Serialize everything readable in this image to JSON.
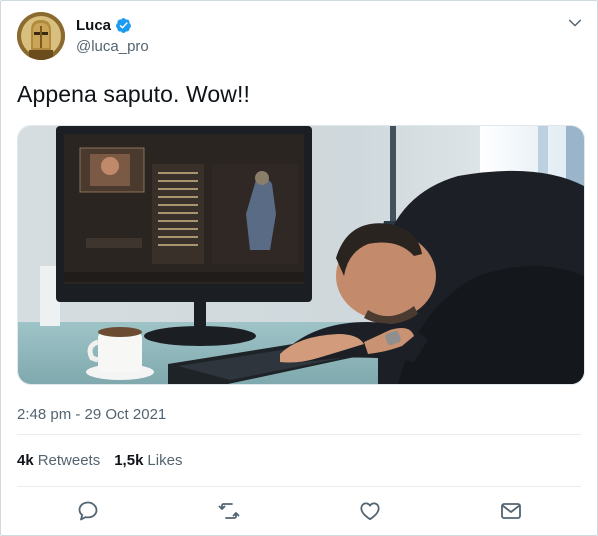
{
  "user": {
    "display_name": "Luca",
    "handle": "@luca_pro"
  },
  "tweet": {
    "text": "Appena saputo. Wow!!",
    "timestamp": "2:48 pm - 29 Oct 2021"
  },
  "stats": {
    "retweets_count": "4k",
    "retweets_label": "Retweets",
    "likes_count": "1,5k",
    "likes_label": "Likes"
  },
  "icons": {
    "verified": "verified-badge-icon",
    "menu": "chevron-down-icon",
    "reply": "reply-icon",
    "retweet": "retweet-icon",
    "like": "heart-icon",
    "share": "mail-icon"
  },
  "colors": {
    "accent": "#1d9bf0",
    "secondary_text": "#536471",
    "border": "#cfd9de"
  }
}
